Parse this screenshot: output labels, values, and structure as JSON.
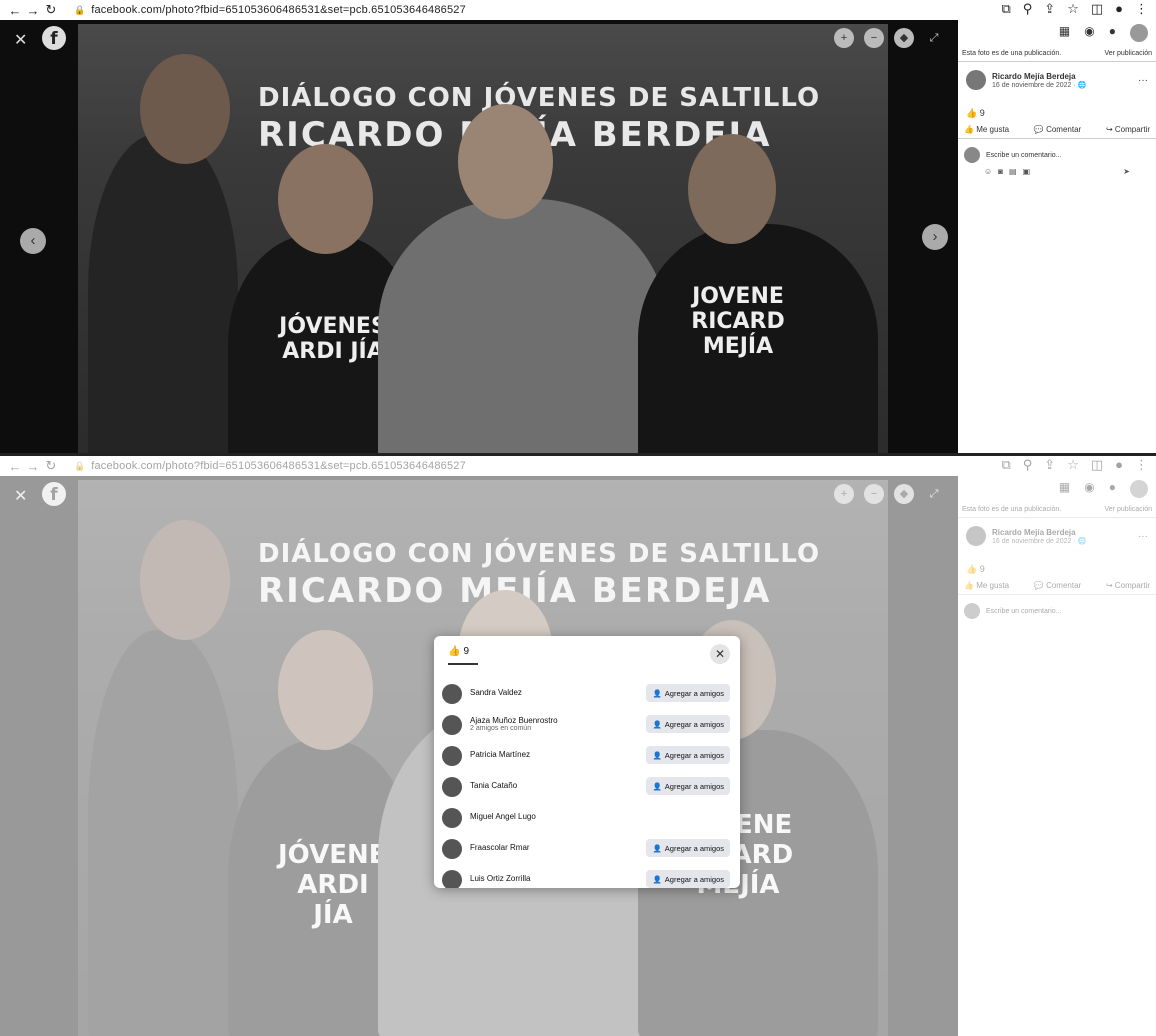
{
  "browser": {
    "url_1": "facebook.com/photo?fbid=651053606486531&set=pcb.651053646486527",
    "url_2": "facebook.com/photo?fbid=651053606486531&set=pcb.651053646486527"
  },
  "photo": {
    "banner_line1": "DIÁLOGO CON JÓVENES DE SALTILLO",
    "banner_line2": "RICARDO MEJÍA BERDEJA",
    "shirt_left": "JÓVENES ARDI JÍA",
    "shirt_right": "JOVENE RICARD MEJÍA"
  },
  "panel": {
    "notice": "Esta foto es de una publicación.",
    "notice_link": "Ver publicación",
    "author_name": "Ricardo Mejía Berdeja",
    "author_date": "16 de noviembre de 2022 · ",
    "reaction_count": "9",
    "like_label": "Me gusta",
    "comment_label": "Comentar",
    "share_label": "Compartir",
    "comment_placeholder": "Escribe un comentario..."
  },
  "modal": {
    "reaction_count": "9",
    "add_friend_label": "Agregar a amigos",
    "rows": [
      {
        "name": "Sandra Valdez",
        "mutual": ""
      },
      {
        "name": "Ajaza Muñoz Buenrostro",
        "mutual": "2 amigos en común"
      },
      {
        "name": "Patricia Martínez",
        "mutual": ""
      },
      {
        "name": "Tania Cataño",
        "mutual": ""
      },
      {
        "name": "Miguel Angel Lugo",
        "mutual": ""
      },
      {
        "name": "Fraascolar Rmar",
        "mutual": ""
      },
      {
        "name": "Luis Ortiz Zorrilla",
        "mutual": ""
      }
    ]
  }
}
